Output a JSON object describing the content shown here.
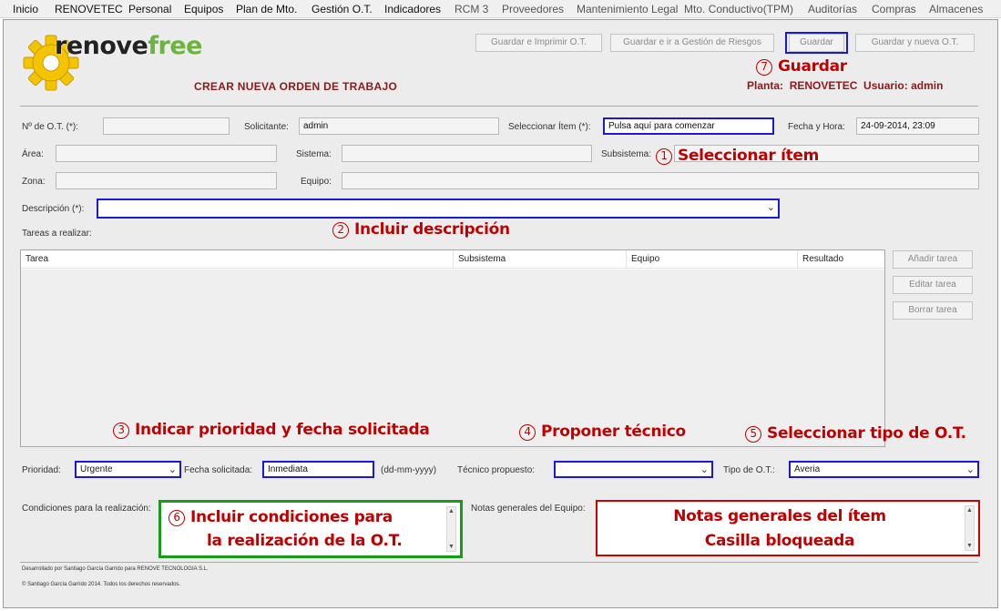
{
  "menu": {
    "items": [
      "Inicio",
      "RENOVETEC",
      "Personal",
      "Equipos",
      "Plan de Mto.",
      "Gestión O.T.",
      "Indicadores",
      "RCM 3",
      "Proveedores",
      "Mantenimiento Legal",
      "Mto. Conductivo(TPM)",
      "Auditorías",
      "Compras",
      "Almacenes"
    ]
  },
  "logo": {
    "part1": "renove",
    "part2": "free"
  },
  "page_title": "CREAR NUEVA ORDEN DE TRABAJO",
  "toolbar": {
    "save_print": "Guardar e Imprimir O.T.",
    "save_risk": "Guardar e ir a Gestión de Riesgos",
    "save": "Guardar",
    "save_new": "Guardar y nueva O.T."
  },
  "status": {
    "planta_label": "Planta:",
    "planta_value": "RENOVETEC",
    "usuario_label": "Usuario:",
    "usuario_value": "admin"
  },
  "form": {
    "ot_label": "Nº de O.T. (*):",
    "ot_value": "",
    "solicitante_label": "Solicitante:",
    "solicitante_value": "admin",
    "item_label": "Seleccionar Ítem (*):",
    "item_value": "Pulsa aquí para comenzar",
    "fecha_label": "Fecha y Hora:",
    "fecha_value": "24-09-2014, 23:09",
    "area_label": "Área:",
    "sistema_label": "Sistema:",
    "subsistema_label": "Subsistema:",
    "zona_label": "Zona:",
    "equipo_label": "Equipo:",
    "descripcion_label": "Descripción (*):",
    "descripcion_value": "",
    "tareas_label": "Tareas a realizar:",
    "prioridad_label": "Prioridad:",
    "prioridad_value": "Urgente",
    "fecha_sol_label": "Fecha solicitada:",
    "fecha_sol_value": "Inmediata",
    "fecha_fmt": "(dd-mm-yyyy)",
    "tecnico_label": "Técnico propuesto:",
    "tecnico_value": "",
    "tipo_label": "Tipo de O.T.:",
    "tipo_value": "Averia",
    "condiciones_label": "Condiciones para la realización:",
    "notas_label": "Notas generales del Equipo:"
  },
  "task_table": {
    "columns": [
      "Tarea",
      "Subsistema",
      "Equipo",
      "Resultado"
    ]
  },
  "task_buttons": {
    "add": "Añadir tarea",
    "edit": "Editar tarea",
    "delete": "Borrar tarea"
  },
  "annotations": {
    "a1": {
      "num": "1",
      "text": "Seleccionar  ítem"
    },
    "a2": {
      "num": "2",
      "text": "Incluir descripción"
    },
    "a3": {
      "num": "3",
      "text": "Indicar prioridad y fecha solicitada"
    },
    "a4": {
      "num": "4",
      "text": "Proponer técnico"
    },
    "a5": {
      "num": "5",
      "text": "Seleccionar tipo de O.T."
    },
    "a6": {
      "num": "6",
      "line1": "Incluir condiciones para",
      "line2": "la realización de la O.T."
    },
    "a7": {
      "num": "7",
      "text": "Guardar"
    },
    "notas_line1": "Notas generales del ítem",
    "notas_line2": "Casilla bloqueada"
  },
  "footer": {
    "line1": "Desarrollado por Santiago García Garrido para RENOVE TECNOLOGIA S.L.",
    "line2": "© Santiago García Garrido 2014. Todos los derechos reservados."
  },
  "colors": {
    "accent_blue": "#1a1ad6",
    "annotation_red": "#c00000",
    "title_red": "#8b1a1a",
    "green_box": "#1a9a1a",
    "logo_green": "#6db33f",
    "logo_gear": "#f5c400"
  }
}
